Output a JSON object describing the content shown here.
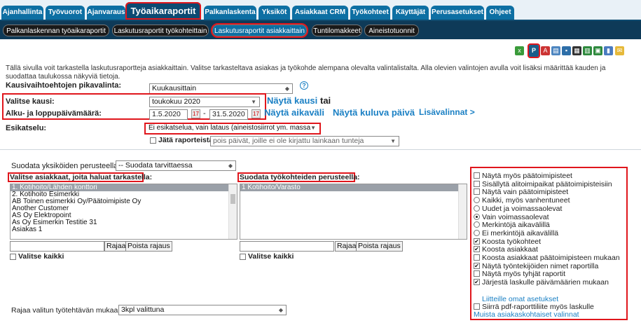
{
  "nav": {
    "tabs": [
      "Ajanhallinta",
      "Työvuorot",
      "Ajanvaraus",
      "Työaikaraportit",
      "Palkanlaskenta",
      "Yksiköt",
      "Asiakkaat CRM",
      "Työkohteet",
      "Käyttäjät",
      "Perusasetukset",
      "Ohjeet"
    ],
    "active": "Työaikaraportit"
  },
  "subnav": {
    "tabs": [
      "Palkanlaskennan työaikaraportit",
      "Laskutusraportit työkohteittain",
      "Laskutusraportit asiakkaittain",
      "Tuntilomakkeet",
      "Aineistotuonnit"
    ],
    "active": "Laskutusraportit asiakkaittain"
  },
  "toolbar": {
    "icons": [
      "excel-icon",
      "pdf-icon",
      "acrobat-icon",
      "print-icon",
      "save-icon",
      "table-icon",
      "export-icon",
      "copy-icon",
      "chart-icon",
      "email-icon"
    ]
  },
  "intro_text": "Tällä sivulla voit tarkastella laskutusraportteja asiakkaittain. Valitse tarkasteltava asiakas ja työkohde alempana olevalta valintalistalta. Alla olevien valintojen avulla voit lisäksi määrittää kauden ja suodattaa taulukossa näkyviä tietoja.",
  "form": {
    "quick_label": "Kausivaihtoehtojen pikavalinta:",
    "quick_value": "Kuukausittain",
    "help_icon": "?",
    "period_label": "Valitse kausi:",
    "period_value": "toukokuu 2020",
    "show_period": "Näytä kausi",
    "or": "tai",
    "range_label": "Alku- ja loppupäivämäärä:",
    "start_date": "1.5.2020",
    "end_date": "31.5.2020",
    "dash": "-",
    "show_range": "Näytä aikaväli",
    "show_current_day": "Näytä kuluva päivä",
    "more_options": "Lisävalinnat >",
    "preview_label": "Esikatselu:",
    "preview_value": "Ei esikatselua, vain lataus (aineistosiirrot ym. massa",
    "leave_out_label": "Jätä raporteista pois:",
    "leave_out_value": "pois päivät, joille ei ole kirjattu lainkaan tunteja"
  },
  "filters": {
    "units_label": "Suodata yksiköiden perusteella:",
    "units_value": "-- Suodata tarvittaessa",
    "customers_label": "Valitse asiakkaat, joita haluat tarkastella:",
    "customers": [
      "1. Kotihoito/Lähden konttori",
      "2. Kotihoito Esimerkki",
      "AB Toinen esimerkki Oy/Päätoimipiste Oy",
      "Another Customer",
      "AS Oy Elektropoint",
      "As Oy Esimerkin Testitie 31",
      "Asiakas 1"
    ],
    "worksites_label": "Suodata työkohteiden perusteella:",
    "worksites": [
      "1 Kotihoito/Varasto"
    ],
    "limit_btn": "Rajaa",
    "clear_btn": "Poista rajaus",
    "select_all": "Valitse kaikki",
    "task_label": "Rajaa valitun työtehtävän mukaan:",
    "task_value": "3kpl valittuna"
  },
  "options": {
    "items": [
      {
        "label": "Näytä myös päätoimipisteet",
        "kind": "checkbox",
        "checked": false
      },
      {
        "label": "Sisällytä alitoimipaikat päätoimipisteisiin",
        "kind": "checkbox",
        "checked": false
      },
      {
        "label": "Näytä vain päätoimipisteet",
        "kind": "checkbox",
        "checked": false
      },
      {
        "label": "Kaikki, myös vanhentuneet",
        "kind": "radio",
        "checked": false
      },
      {
        "label": "Uudet ja voimassaolevat",
        "kind": "radio",
        "checked": false
      },
      {
        "label": "Vain voimassaolevat",
        "kind": "radio",
        "checked": true
      },
      {
        "label": "Merkintöjä aikavälillä",
        "kind": "radio",
        "checked": false
      },
      {
        "label": "Ei merkintöjä aikavälillä",
        "kind": "radio",
        "checked": false
      },
      {
        "label": "Koosta työkohteet",
        "kind": "checkbox",
        "checked": true
      },
      {
        "label": "Koosta asiakkaat",
        "kind": "checkbox",
        "checked": true
      },
      {
        "label": "Koosta asiakkaat päätoimipisteen mukaan",
        "kind": "checkbox",
        "checked": false
      },
      {
        "label": "Näytä työntekijöiden nimet raportilla",
        "kind": "checkbox",
        "checked": true
      },
      {
        "label": "Näytä myös tyhjät raportit",
        "kind": "checkbox",
        "checked": false
      },
      {
        "label": "Järjestä laskulle päivämäärien mukaan",
        "kind": "checkbox",
        "checked": true
      }
    ],
    "attachments_link": "Liitteille omat asetukset",
    "move_pdf": "Siirrä pdf-raporttiliite myös laskulle",
    "customer_settings_link": "Muista asiakaskohtaiset valinnat"
  },
  "colors": {
    "nav_blue": "#0d6fa3",
    "dark_blue": "#0e3a58",
    "highlight_red": "#e0161c",
    "link_blue": "#1b80c4"
  }
}
